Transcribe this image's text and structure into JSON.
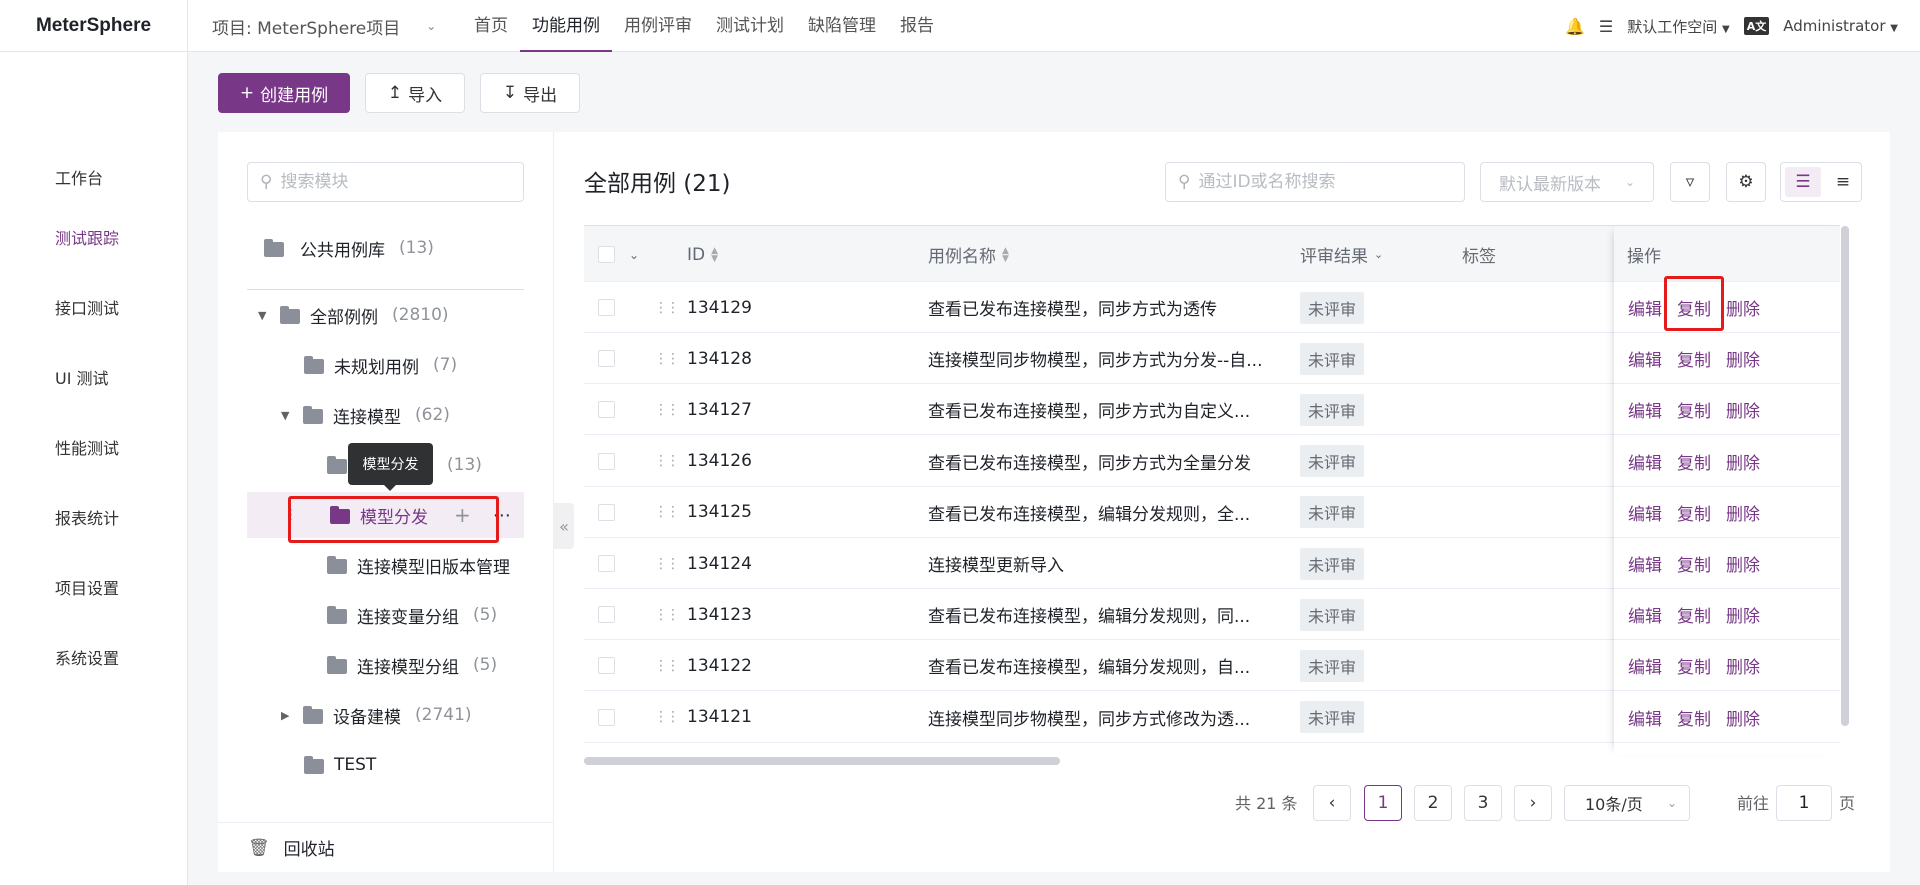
{
  "app": {
    "logo": "MeterSphere"
  },
  "header": {
    "project_label": "项目: MeterSphere项目",
    "nav": [
      "首页",
      "功能用例",
      "用例评审",
      "测试计划",
      "缺陷管理",
      "报告"
    ],
    "workspace": "默认工作空间",
    "lang_icon": "A文",
    "user": "Administrator"
  },
  "sidebar": {
    "items": [
      "工作台",
      "测试跟踪",
      "接口测试",
      "UI 测试",
      "性能测试",
      "报表统计",
      "项目设置",
      "系统设置"
    ]
  },
  "toolbar": {
    "create": "创建用例",
    "import": "导入",
    "export": "导出"
  },
  "tree": {
    "search_placeholder": "搜索模块",
    "public_lib": {
      "label": "公共用例库",
      "count": "(13)"
    },
    "all": {
      "label": "全部例例",
      "count": "(2810)"
    },
    "unplanned": {
      "label": "未规划用例",
      "count": "(7)"
    },
    "connect_model": {
      "label": "连接模型",
      "count": "(62)"
    },
    "hidden_child": {
      "count": "(13)"
    },
    "model_dist": {
      "label": "模型分发"
    },
    "old_version": {
      "label": "连接模型旧版本管理"
    },
    "var_group": {
      "label": "连接变量分组",
      "count": "(5)"
    },
    "model_group": {
      "label": "连接模型分组",
      "count": "(5)"
    },
    "device": {
      "label": "设备建模",
      "count": "(2741)"
    },
    "test": {
      "label": "TEST"
    },
    "tooltip": "模型分发",
    "recycle": "回收站"
  },
  "main": {
    "title": "全部用例 (21)",
    "search_placeholder": "通过ID或名称搜索",
    "version_placeholder": "默认最新版本",
    "columns": {
      "id": "ID",
      "name": "用例名称",
      "review": "评审结果",
      "tags": "标签",
      "ops": "操作"
    },
    "ops": {
      "edit": "编辑",
      "copy": "复制",
      "delete": "删除"
    },
    "rows": [
      {
        "id": "134129",
        "name": "查看已发布连接模型，同步方式为透传",
        "review": "未评审"
      },
      {
        "id": "134128",
        "name": "连接模型同步物模型，同步方式为分发--自...",
        "review": "未评审"
      },
      {
        "id": "134127",
        "name": "查看已发布连接模型，同步方式为自定义...",
        "review": "未评审"
      },
      {
        "id": "134126",
        "name": "查看已发布连接模型，同步方式为全量分发",
        "review": "未评审"
      },
      {
        "id": "134125",
        "name": "查看已发布连接模型，编辑分发规则，全...",
        "review": "未评审"
      },
      {
        "id": "134124",
        "name": "连接模型更新导入",
        "review": "未评审"
      },
      {
        "id": "134123",
        "name": "查看已发布连接模型，编辑分发规则，同...",
        "review": "未评审"
      },
      {
        "id": "134122",
        "name": "查看已发布连接模型，编辑分发规则，自...",
        "review": "未评审"
      },
      {
        "id": "134121",
        "name": "连接模型同步物模型，同步方式修改为透...",
        "review": "未评审"
      }
    ]
  },
  "pagination": {
    "total": "共 21 条",
    "pages": [
      "1",
      "2",
      "3"
    ],
    "page_size": "10条/页",
    "goto_label": "前往",
    "goto_value": "1",
    "page_unit": "页"
  },
  "colors": {
    "accent": "#783887",
    "highlight_box": "#e51b1b"
  }
}
